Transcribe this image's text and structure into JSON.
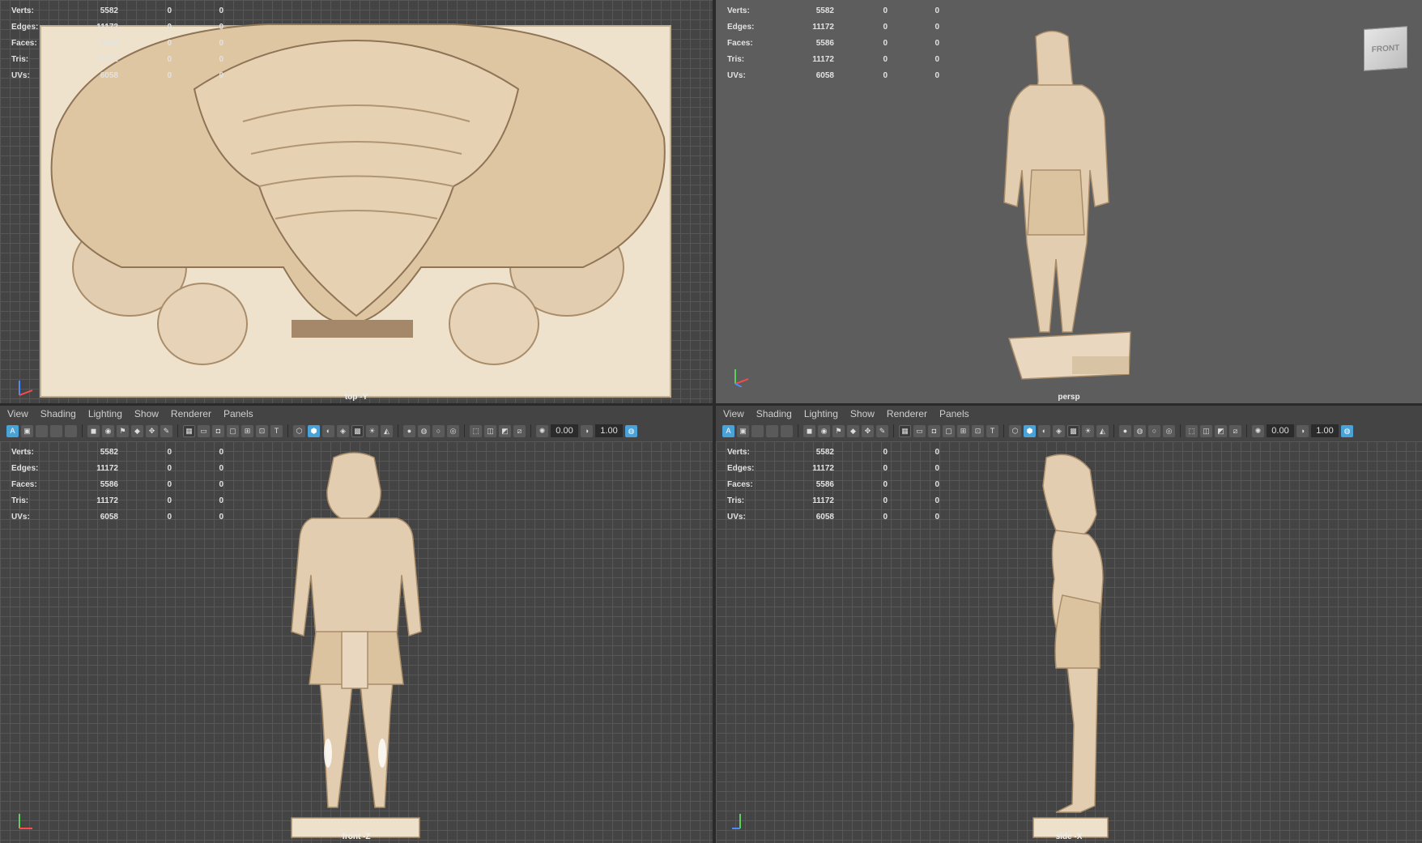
{
  "stats": {
    "labels": [
      "Verts:",
      "Edges:",
      "Faces:",
      "Tris:",
      "UVs:"
    ],
    "col1": [
      "5582",
      "11172",
      "5586",
      "11172",
      "6058"
    ],
    "col2": [
      "0",
      "0",
      "0",
      "0",
      "0"
    ],
    "col3": [
      "0",
      "0",
      "0",
      "0",
      "0"
    ]
  },
  "viewports": {
    "top": {
      "camera": "top -Y"
    },
    "persp": {
      "camera": "persp",
      "viewcube_face": "FRONT"
    },
    "front": {
      "camera": "front -Z"
    },
    "side": {
      "camera": "side -X"
    }
  },
  "panel_menu": [
    "View",
    "Shading",
    "Lighting",
    "Show",
    "Renderer",
    "Panels"
  ],
  "toolbar": {
    "exposure": "0.00",
    "gamma": "1.00",
    "select_camera_icon": "camera-icon"
  },
  "colors": {
    "statue": "#e3cdb0",
    "statue_shadow": "#b79d7c",
    "viewport_bg": "#5d5d5d",
    "grid_bg": "#444444",
    "accent": "#4aa3d8"
  }
}
